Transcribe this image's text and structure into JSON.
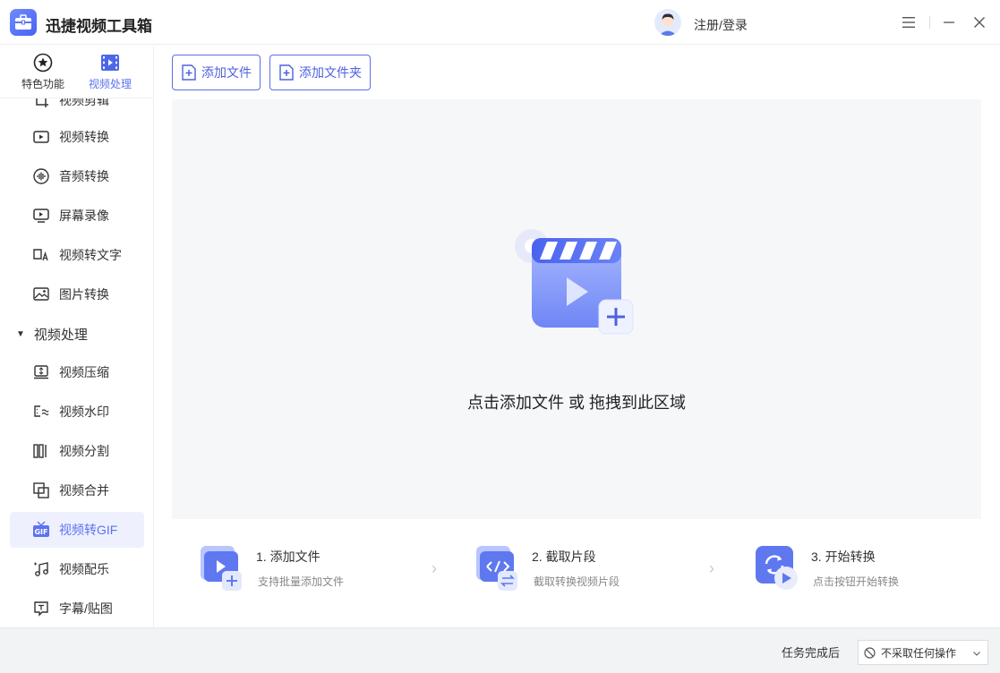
{
  "app": {
    "title": "迅捷视频工具箱",
    "login_label": "注册/登录",
    "accent": "#5b73f0"
  },
  "sidebar": {
    "tabs": [
      {
        "label": "特色功能",
        "icon": "star-icon"
      },
      {
        "label": "视频处理",
        "icon": "film-icon"
      }
    ],
    "items_top": [
      {
        "label": "视频剪辑",
        "icon": "crop-icon"
      },
      {
        "label": "视频转换",
        "icon": "video-convert-icon"
      },
      {
        "label": "音频转换",
        "icon": "audio-wave-icon"
      },
      {
        "label": "屏幕录像",
        "icon": "screen-record-icon"
      },
      {
        "label": "视频转文字",
        "icon": "video-to-text-icon"
      },
      {
        "label": "图片转换",
        "icon": "image-icon"
      }
    ],
    "group": {
      "label": "视频处理"
    },
    "items_group": [
      {
        "label": "视频压缩",
        "icon": "compress-icon"
      },
      {
        "label": "视频水印",
        "icon": "watermark-icon"
      },
      {
        "label": "视频分割",
        "icon": "split-icon"
      },
      {
        "label": "视频合并",
        "icon": "merge-icon"
      },
      {
        "label": "视频转GIF",
        "icon": "gif-icon",
        "active": true
      },
      {
        "label": "视频配乐",
        "icon": "music-icon"
      },
      {
        "label": "字幕/贴图",
        "icon": "subtitle-icon"
      }
    ]
  },
  "toolbar": {
    "add_file": "添加文件",
    "add_folder": "添加文件夹"
  },
  "dropzone": {
    "hint": "点击添加文件 或 拖拽到此区域"
  },
  "steps": [
    {
      "title": "1. 添加文件",
      "desc": "支持批量添加文件"
    },
    {
      "title": "2. 截取片段",
      "desc": "截取转换视频片段"
    },
    {
      "title": "3. 开始转换",
      "desc": "点击按钮开始转换"
    }
  ],
  "footer": {
    "after_label": "任务完成后",
    "after_value": "不采取任何操作"
  }
}
